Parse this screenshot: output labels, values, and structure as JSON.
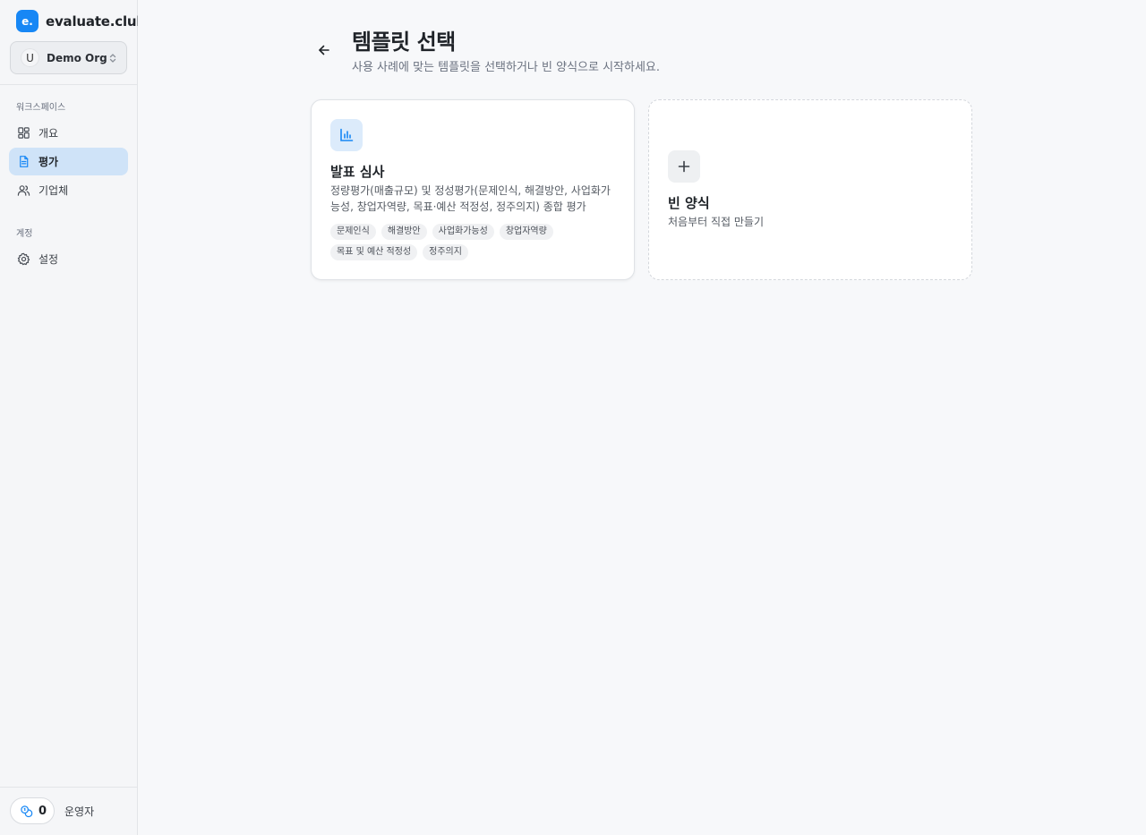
{
  "brand": {
    "logo_text": "e.",
    "name": "evaluate.club"
  },
  "org": {
    "avatar": "U",
    "name": "Demo Org",
    "icon": "chevrons-up-down-icon"
  },
  "sidebar": {
    "workspace_label": "워크스페이스",
    "account_label": "계정",
    "items": [
      {
        "label": "개요",
        "icon": "grid-icon",
        "active": false
      },
      {
        "label": "평가",
        "icon": "document-icon",
        "active": true
      },
      {
        "label": "기업체",
        "icon": "users-icon",
        "active": false
      },
      {
        "label": "설정",
        "icon": "gear-icon",
        "active": false
      }
    ],
    "credits": {
      "count": "0",
      "icon": "coins-icon"
    },
    "role": "운영자"
  },
  "page": {
    "title": "템플릿 선택",
    "subtitle": "사용 사례에 맞는 템플릿을 선택하거나 빈 양식으로 시작하세요.",
    "back_icon": "arrow-left-icon"
  },
  "templates": [
    {
      "title": "발표 심사",
      "description": "정량평가(매출규모) 및 정성평가(문제인식, 해결방안, 사업화가능성, 창업자역량, 목표·예산 적정성, 정주의지) 종합 평가",
      "icon": "bar-chart-icon",
      "tags": [
        "문제인식",
        "해결방안",
        "사업화가능성",
        "창업자역량",
        "목표 및 예산 적정성",
        "정주의지"
      ]
    },
    {
      "title": "빈 양식",
      "description": "처음부터 직접 만들기",
      "icon": "plus-icon"
    }
  ],
  "colors": {
    "accent": "#1787f5",
    "active_nav_bg": "#cfe3f8",
    "icon_bg": "#dcebfb"
  }
}
